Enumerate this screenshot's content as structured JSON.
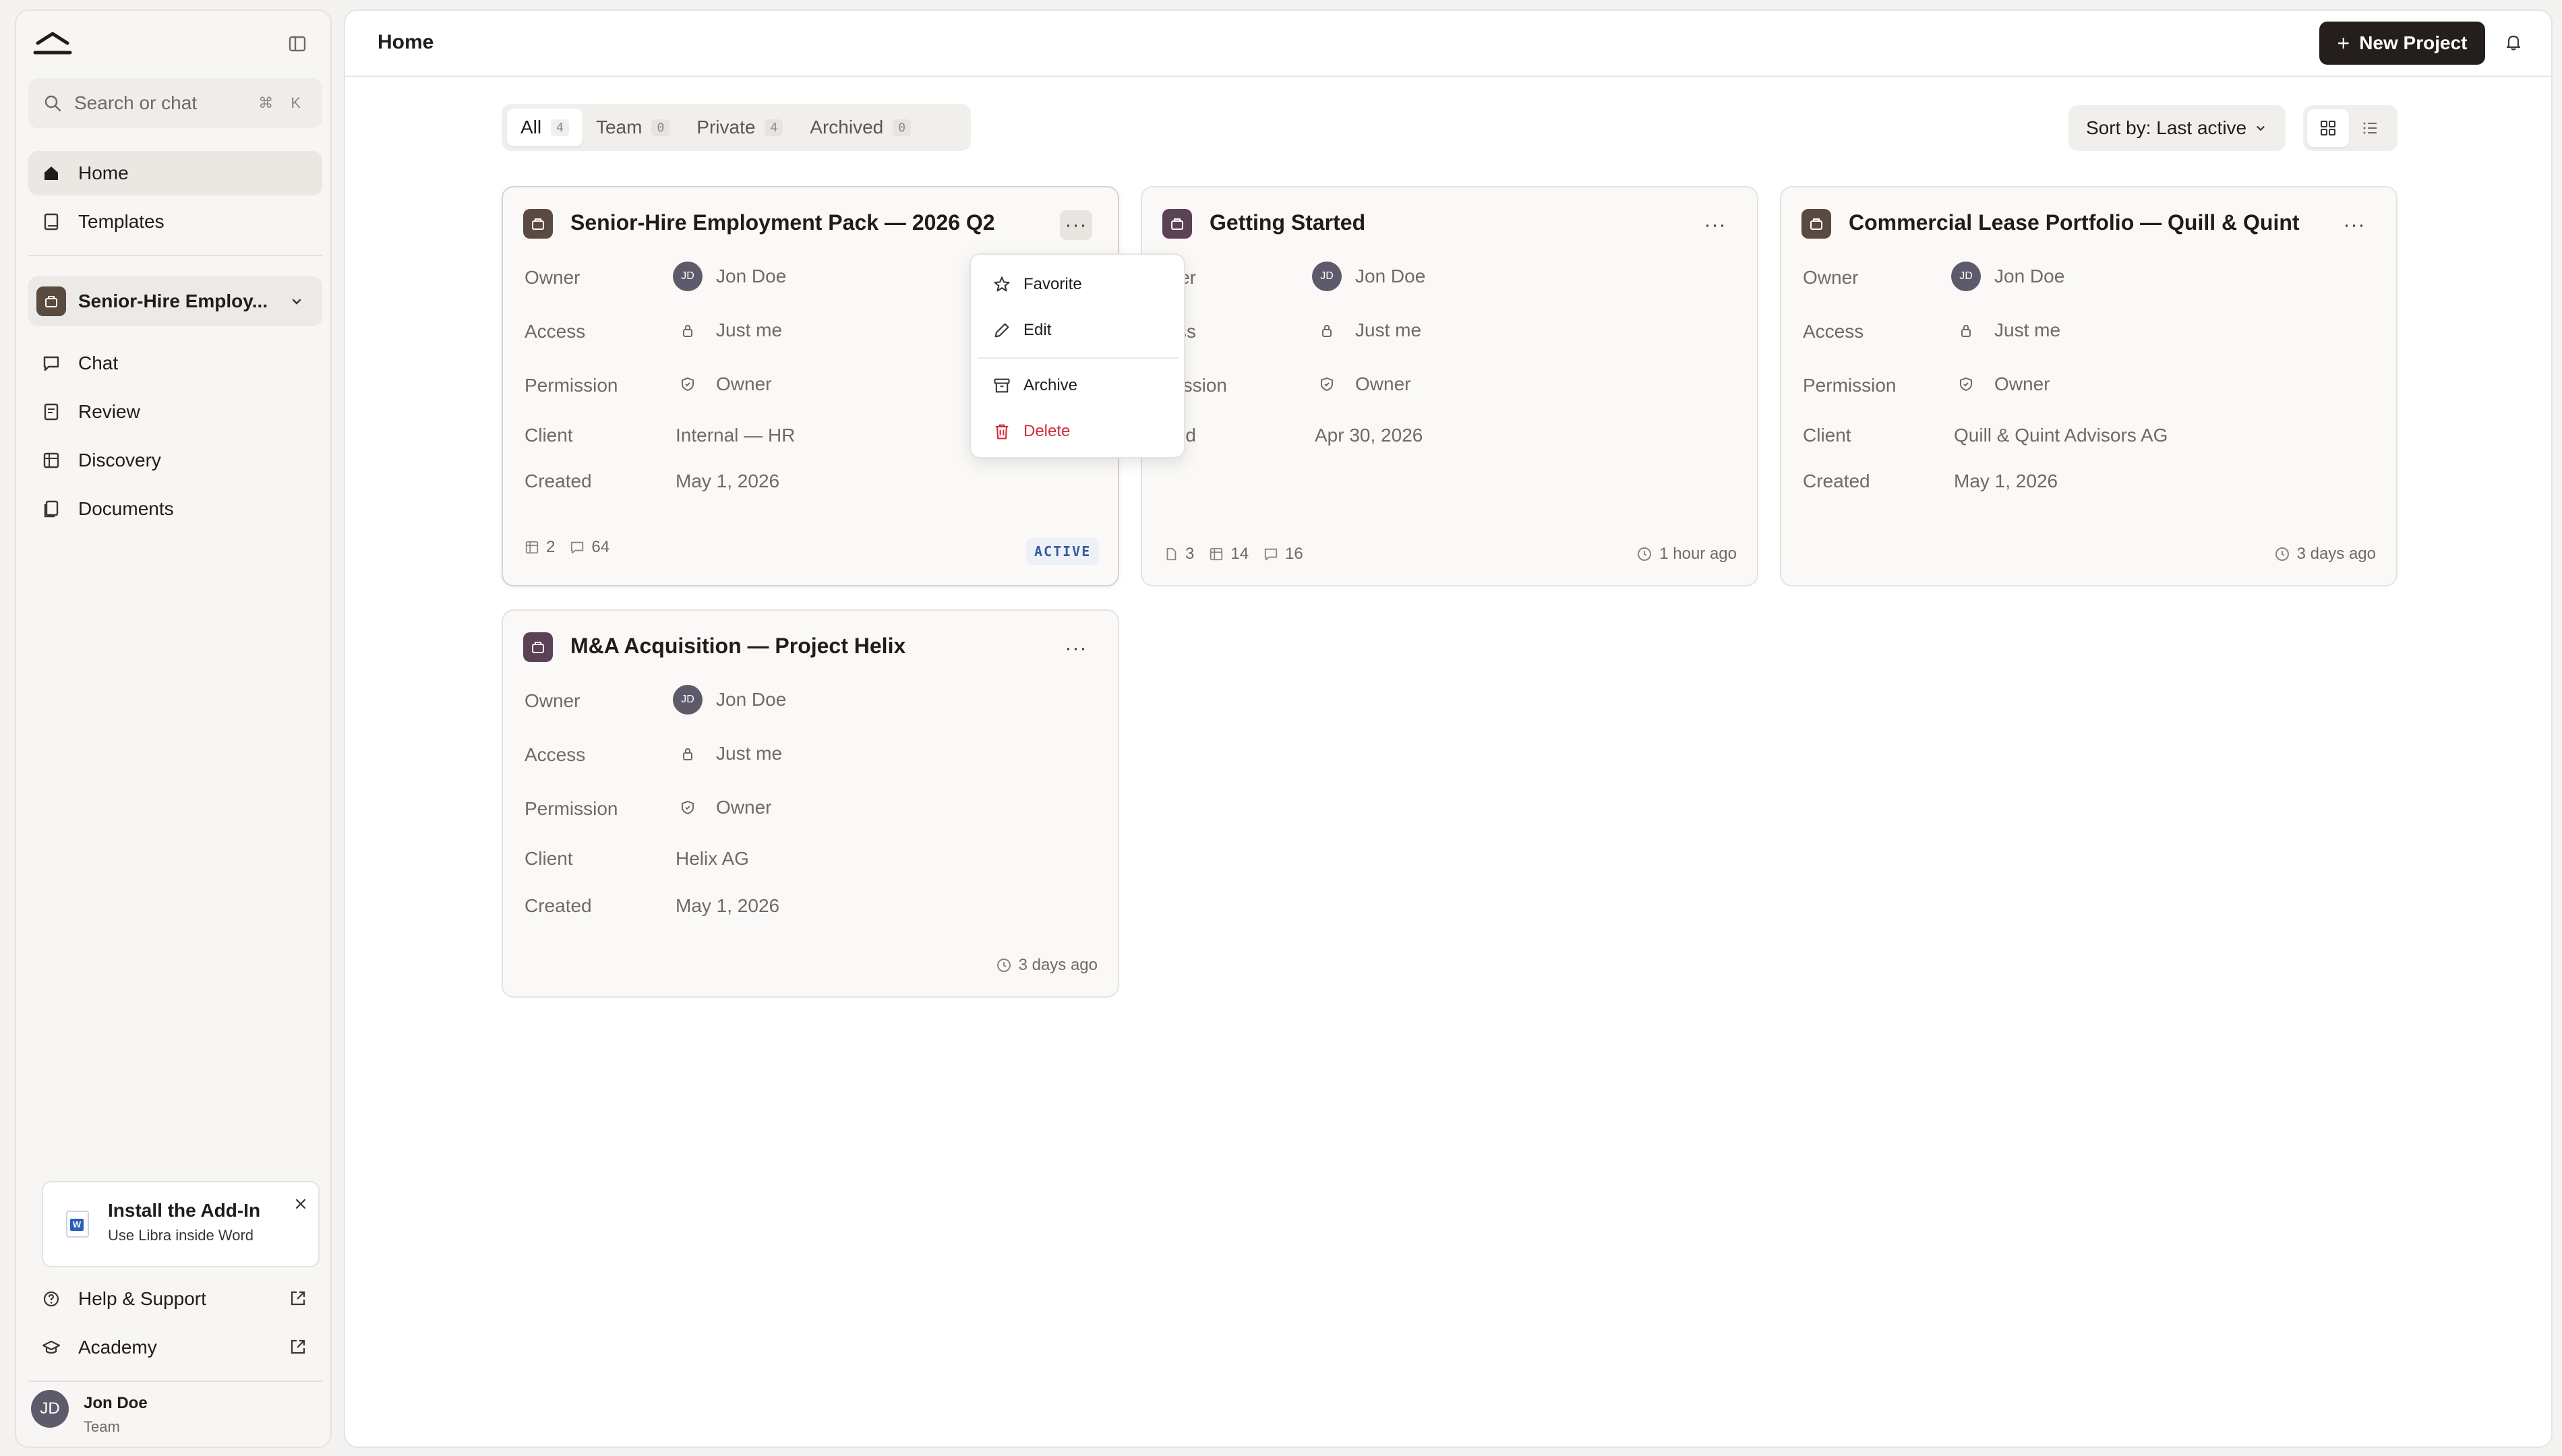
{
  "sidebar": {
    "search_placeholder": "Search or chat",
    "search_shortcut": "⌘ K",
    "nav": [
      {
        "label": "Home",
        "icon": "home-icon"
      },
      {
        "label": "Templates",
        "icon": "book-icon"
      }
    ],
    "project_name": "Senior-Hire Employ...",
    "project_nav": [
      {
        "label": "Chat",
        "icon": "chat-icon"
      },
      {
        "label": "Review",
        "icon": "review-icon"
      },
      {
        "label": "Discovery",
        "icon": "table-icon"
      },
      {
        "label": "Documents",
        "icon": "documents-icon"
      }
    ],
    "addin": {
      "title": "Install the Add-In",
      "subtitle": "Use Libra inside Word",
      "icon_letter": "W"
    },
    "footer": [
      {
        "label": "Help & Support",
        "icon": "help-icon"
      },
      {
        "label": "Academy",
        "icon": "academy-icon"
      }
    ],
    "user": {
      "initials": "JD",
      "name": "Jon Doe",
      "role": "Team"
    }
  },
  "header": {
    "title": "Home",
    "new_project_label": "New Project"
  },
  "tabs": [
    {
      "label": "All",
      "count": "4"
    },
    {
      "label": "Team",
      "count": "0"
    },
    {
      "label": "Private",
      "count": "4"
    },
    {
      "label": "Archived",
      "count": "0"
    }
  ],
  "sort_label": "Sort by: Last active",
  "field_labels": {
    "owner": "Owner",
    "access": "Access",
    "permission": "Permission",
    "client": "Client",
    "created": "Created"
  },
  "cards": [
    {
      "title": "Senior-Hire Employment Pack — 2026 Q2",
      "owner_initials": "JD",
      "owner": "Jon Doe",
      "access": "Just me",
      "permission": "Owner",
      "client": "Internal — HR",
      "created": "May 1, 2026",
      "stats": {
        "tables": "2",
        "messages": "64"
      },
      "badge": "ACTIVE"
    },
    {
      "title": "Getting Started",
      "owner_initials": "JD",
      "owner": "Jon Doe",
      "access": "Just me",
      "permission": "Owner",
      "client_label_visible": "eated",
      "created": "Apr 30, 2026",
      "stats": {
        "docs": "3",
        "tables": "14",
        "messages": "16"
      },
      "time": "1 hour ago",
      "labels_visible": {
        "owner": "vner",
        "access": "cess",
        "permission": "rmission"
      }
    },
    {
      "title": "Commercial Lease Portfolio — Quill & Quint",
      "owner_initials": "JD",
      "owner": "Jon Doe",
      "access": "Just me",
      "permission": "Owner",
      "client": "Quill & Quint Advisors AG",
      "created": "May 1, 2026",
      "time": "3 days ago"
    },
    {
      "title": "M&A Acquisition — Project Helix",
      "owner_initials": "JD",
      "owner": "Jon Doe",
      "access": "Just me",
      "permission": "Owner",
      "client": "Helix AG",
      "created": "May 1, 2026",
      "time": "3 days ago"
    }
  ],
  "card_menu": {
    "dots": "···",
    "items": [
      {
        "label": "Favorite",
        "icon": "star-icon"
      },
      {
        "label": "Edit",
        "icon": "pencil-icon"
      },
      {
        "label": "Archive",
        "icon": "archive-icon"
      },
      {
        "label": "Delete",
        "icon": "trash-icon",
        "color": "#d22c3a"
      }
    ]
  },
  "colors": {
    "accent_dark": "#241f1c",
    "project_icon_brown": "#5b4a3f",
    "project_icon_purple": "#5c4257",
    "danger": "#d22c3a",
    "badge_active": "#3a5a9c"
  }
}
